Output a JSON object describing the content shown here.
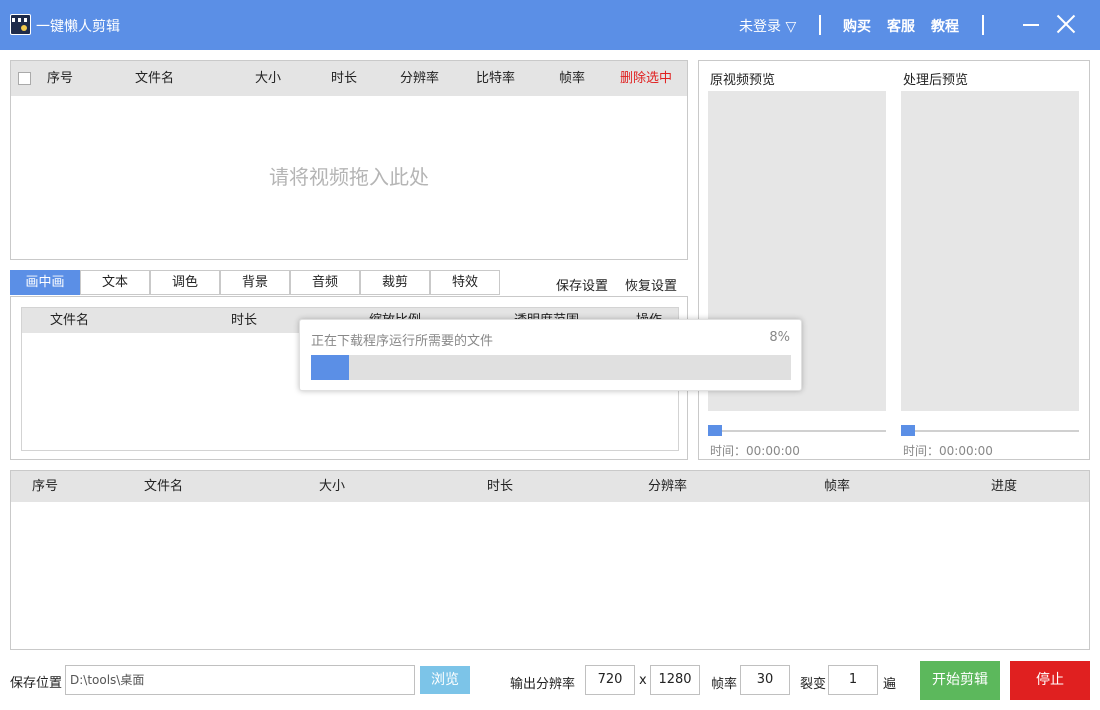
{
  "app": {
    "title": "一键懒人剪辑"
  },
  "titlebar": {
    "login": "未登录 ▽",
    "buy": "购买",
    "service": "客服",
    "tutorial": "教程"
  },
  "file_table": {
    "columns": [
      "序号",
      "文件名",
      "大小",
      "时长",
      "分辨率",
      "比特率",
      "帧率"
    ],
    "delete_selected": "删除选中",
    "drop_hint": "请将视频拖入此处"
  },
  "tabs": [
    "画中画",
    "文本",
    "调色",
    "背景",
    "音频",
    "裁剪",
    "特效"
  ],
  "settings": {
    "save": "保存设置",
    "restore": "恢复设置"
  },
  "pip_table": {
    "columns": [
      "文件名",
      "时长",
      "缩放比例",
      "透明度范围",
      "操作"
    ]
  },
  "preview": {
    "original_title": "原视频预览",
    "processed_title": "处理后预览",
    "original_time": "时间：00:00:00",
    "processed_time": "时间：00:00:00"
  },
  "output_table": {
    "columns": [
      "序号",
      "文件名",
      "大小",
      "时长",
      "分辨率",
      "帧率",
      "进度"
    ]
  },
  "bottom": {
    "save_location_label": "保存位置",
    "save_path": "D:\\tools\\桌面",
    "browse": "浏览",
    "output_resolution_label": "输出分辨率",
    "width": "720",
    "x": "x",
    "height": "1280",
    "fps_label": "帧率",
    "fps": "30",
    "split_label": "裂变",
    "split": "1",
    "split_unit": "遍",
    "start": "开始剪辑",
    "stop": "停止"
  },
  "progress": {
    "message": "正在下载程序运行所需要的文件",
    "percent_text": "8%",
    "percent": 8
  },
  "colors": {
    "accent": "#5b8fe6",
    "danger": "#e02020",
    "success": "#5cb85c",
    "browse": "#7cc4e8"
  }
}
